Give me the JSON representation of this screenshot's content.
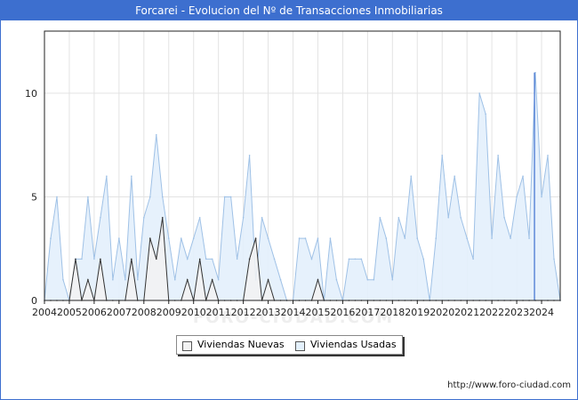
{
  "chart_data": {
    "type": "area",
    "title": "Forcarei - Evolucion del Nº de Transacciones Inmobiliarias",
    "xlabel": "",
    "ylabel": "",
    "x_range": [
      2004.0,
      2024.75
    ],
    "ylim": [
      0,
      13
    ],
    "y_ticks": [
      0,
      5,
      10
    ],
    "x_ticks": [
      "2004",
      "2005",
      "2006",
      "2007",
      "2008",
      "2009",
      "2010",
      "2011",
      "2012",
      "2013",
      "2014",
      "2015",
      "2016",
      "2017",
      "2018",
      "2019",
      "2020",
      "2021",
      "2022",
      "2023",
      "2024"
    ],
    "grid": true,
    "legend_position": "bottom-center",
    "series": [
      {
        "name": "Viviendas Nuevas",
        "color": "#f2f2f2",
        "line_color": "#333333",
        "x": [
          2004.0,
          2004.25,
          2004.5,
          2004.75,
          2005.0,
          2005.25,
          2005.5,
          2005.75,
          2006.0,
          2006.25,
          2006.5,
          2006.75,
          2007.0,
          2007.25,
          2007.5,
          2007.75,
          2008.0,
          2008.25,
          2008.5,
          2008.75,
          2009.0,
          2009.25,
          2009.5,
          2009.75,
          2010.0,
          2010.25,
          2010.5,
          2010.75,
          2011.0,
          2011.25,
          2011.5,
          2011.75,
          2012.0,
          2012.25,
          2012.5,
          2012.75,
          2013.0,
          2013.25,
          2013.5,
          2013.75,
          2014.0,
          2014.25,
          2014.5,
          2014.75,
          2015.0,
          2015.25,
          2015.5,
          2015.75,
          2016.0,
          2016.25,
          2016.5,
          2016.75,
          2017.0,
          2017.25,
          2017.5,
          2017.75,
          2018.0,
          2018.25,
          2018.5,
          2018.75,
          2019.0,
          2019.25,
          2019.5,
          2019.75,
          2020.0,
          2020.25,
          2020.5,
          2020.75,
          2021.0,
          2021.25,
          2021.5,
          2021.75,
          2022.0,
          2022.25,
          2022.5,
          2022.75,
          2023.0,
          2023.25,
          2023.5,
          2023.75,
          2024.0,
          2024.25,
          2024.5,
          2024.75
        ],
        "values": [
          0,
          0,
          0,
          0,
          0,
          2,
          0,
          1,
          0,
          2,
          0,
          0,
          0,
          0,
          2,
          0,
          0,
          3,
          2,
          4,
          0,
          0,
          0,
          1,
          0,
          2,
          0,
          1,
          0,
          0,
          0,
          0,
          0,
          2,
          3,
          0,
          1,
          0,
          0,
          0,
          0,
          0,
          0,
          0,
          1,
          0,
          0,
          0,
          0,
          0,
          0,
          0,
          0,
          0,
          0,
          0,
          0,
          0,
          0,
          0,
          0,
          0,
          0,
          0,
          0,
          0,
          0,
          0,
          0,
          0,
          0,
          0,
          0,
          0,
          0,
          0,
          0,
          0,
          0,
          0,
          0,
          0,
          0,
          0
        ]
      },
      {
        "name": "Viviendas Usadas",
        "color": "#e3f0fc",
        "line_color": "#9fc1e6",
        "x": [
          2004.0,
          2004.25,
          2004.5,
          2004.75,
          2005.0,
          2005.25,
          2005.5,
          2005.75,
          2006.0,
          2006.25,
          2006.5,
          2006.75,
          2007.0,
          2007.25,
          2007.5,
          2007.75,
          2008.0,
          2008.25,
          2008.5,
          2008.75,
          2009.0,
          2009.25,
          2009.5,
          2009.75,
          2010.0,
          2010.25,
          2010.5,
          2010.75,
          2011.0,
          2011.25,
          2011.5,
          2011.75,
          2012.0,
          2012.25,
          2012.5,
          2012.75,
          2013.0,
          2013.25,
          2013.5,
          2013.75,
          2014.0,
          2014.25,
          2014.5,
          2014.75,
          2015.0,
          2015.25,
          2015.5,
          2015.75,
          2016.0,
          2016.25,
          2016.5,
          2016.75,
          2017.0,
          2017.25,
          2017.5,
          2017.75,
          2018.0,
          2018.25,
          2018.5,
          2018.75,
          2019.0,
          2019.25,
          2019.5,
          2019.75,
          2020.0,
          2020.25,
          2020.5,
          2020.75,
          2021.0,
          2021.25,
          2021.5,
          2021.75,
          2022.0,
          2022.25,
          2022.5,
          2022.75,
          2023.0,
          2023.25,
          2023.5,
          2023.75,
          2024.0,
          2024.25,
          2024.5,
          2024.75
        ],
        "values": [
          0,
          3,
          5,
          1,
          0,
          2,
          2,
          5,
          2,
          4,
          6,
          1,
          3,
          1,
          6,
          1,
          4,
          5,
          8,
          5,
          3,
          1,
          3,
          2,
          3,
          4,
          2,
          2,
          1,
          5,
          5,
          2,
          4,
          7,
          1,
          4,
          3,
          2,
          1,
          0,
          0,
          3,
          3,
          2,
          3,
          0,
          3,
          1,
          0,
          2,
          2,
          2,
          1,
          1,
          4,
          3,
          1,
          4,
          3,
          6,
          3,
          2,
          0,
          3,
          7,
          4,
          6,
          4,
          3,
          2,
          10,
          9,
          3,
          7,
          4,
          3,
          5,
          6,
          3,
          11,
          5,
          7,
          2,
          0
        ]
      }
    ]
  },
  "source": "http://www.foro-ciudad.com",
  "watermark": "FORO-CIUDAD.COM"
}
